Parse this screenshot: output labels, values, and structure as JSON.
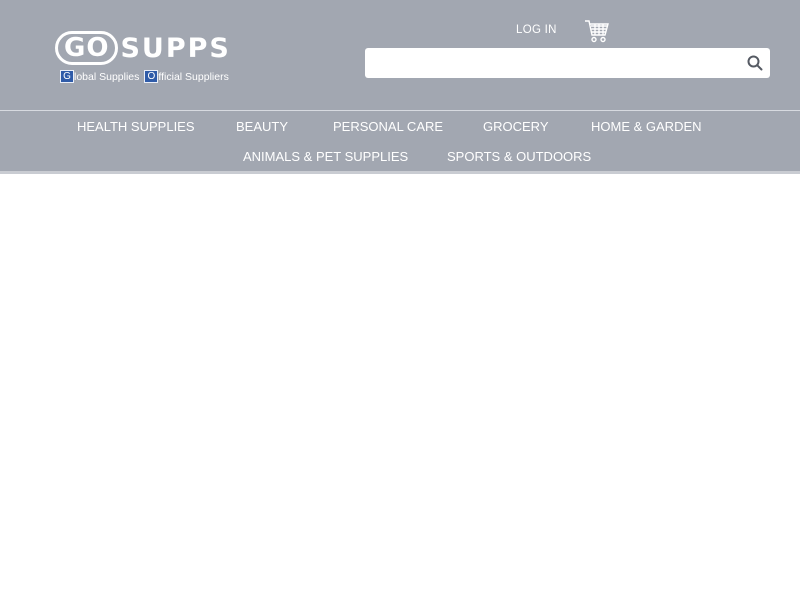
{
  "brand": {
    "logo_go": "GO",
    "logo_supps": "SUPPS",
    "tag_g": "G",
    "tag_part1": "lobal Supplies",
    "tag_o": "O",
    "tag_part2": "fficial Suppliers"
  },
  "header": {
    "login_label": "LOG IN",
    "cart_icon": "cart-icon",
    "search": {
      "value": "",
      "placeholder": "",
      "icon": "search-icon"
    }
  },
  "nav": {
    "items": [
      "HEALTH SUPPLIES",
      "BEAUTY",
      "PERSONAL CARE",
      "GROCERY",
      "HOME & GARDEN",
      "ANIMALS & PET SUPPLIES",
      "SPORTS & OUTDOORS"
    ]
  },
  "colors": {
    "header_bg": "#a2a7b1",
    "text": "#ffffff",
    "logo_box": "#2f5ba8"
  }
}
